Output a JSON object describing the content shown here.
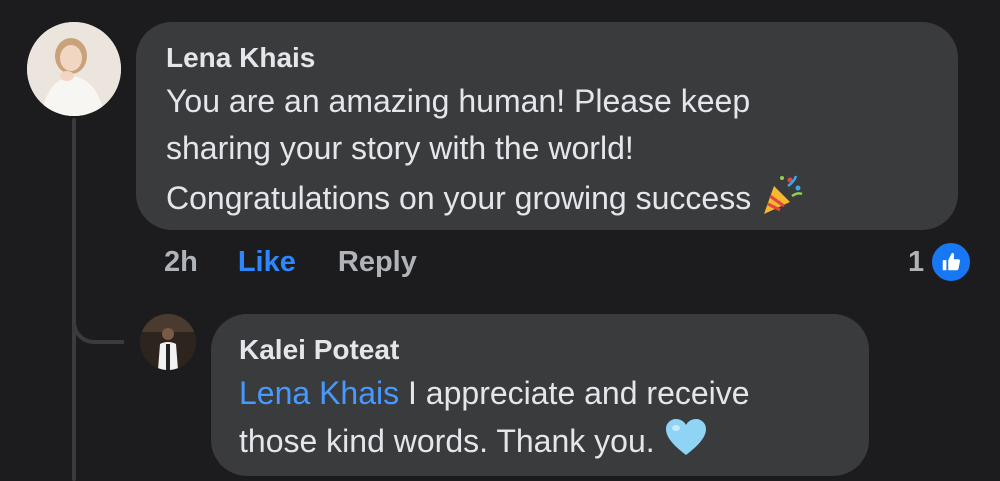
{
  "comment": {
    "author": "Lena Khais",
    "text_line1": "You are an amazing human! Please keep",
    "text_line2": "sharing your story with the world!",
    "text_line3": "Congratulations on your growing success",
    "emoji": "party-popper",
    "time": "2h",
    "like_label": "Like",
    "reply_label": "Reply",
    "reaction_count": "1",
    "reaction_type": "like"
  },
  "reply": {
    "author": "Kalei Poteat",
    "mention": "Lena Khais",
    "text_line1": " I appreciate and receive",
    "text_line2": "those kind words. Thank you.",
    "emoji": "light-blue-heart"
  },
  "colors": {
    "background": "#1c1c1e",
    "bubble": "#3a3b3c",
    "text": "#e4e6eb",
    "secondary_text": "#b0b3b8",
    "like_blue": "#2d88ff",
    "mention_blue": "#4599ff"
  }
}
